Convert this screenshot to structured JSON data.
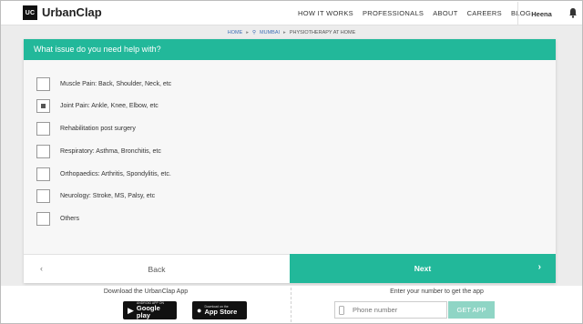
{
  "header": {
    "logo_mark": "UC",
    "brand": "UrbanClap",
    "nav": [
      "HOW IT WORKS",
      "PROFESSIONALS",
      "ABOUT",
      "CAREERS",
      "BLOG"
    ],
    "user_name": "Heena",
    "notification_icon": "bell-icon"
  },
  "breadcrumb": {
    "home": "HOME",
    "city": "MUMBAI",
    "current": "PHYSIOTHERAPY AT HOME"
  },
  "question": {
    "title": "What issue do you need help with?",
    "options": [
      {
        "label": "Muscle Pain: Back, Shoulder, Neck, etc",
        "checked": false
      },
      {
        "label": "Joint Pain: Ankle, Knee, Elbow, etc",
        "checked": true
      },
      {
        "label": "Rehabilitation post surgery",
        "checked": false
      },
      {
        "label": "Respiratory: Asthma, Bronchitis, etc",
        "checked": false
      },
      {
        "label": "Orthopaedics: Arthritis, Spondylitis, etc.",
        "checked": false
      },
      {
        "label": "Neurology: Stroke, MS, Palsy, etc",
        "checked": false
      },
      {
        "label": "Others",
        "checked": false
      }
    ],
    "back_label": "Back",
    "next_label": "Next"
  },
  "footer": {
    "download_title": "Download the UrbanClap App",
    "google_play": {
      "small": "ANDROID APP ON",
      "big": "Google play"
    },
    "app_store": {
      "small": "Download on the",
      "big": "App Store"
    },
    "phone_title": "Enter your number to get the app",
    "phone_placeholder": "Phone number",
    "get_app_label": "GET APP"
  },
  "colors": {
    "accent": "#22b89a",
    "get_app_button": "#8fd5c5"
  }
}
